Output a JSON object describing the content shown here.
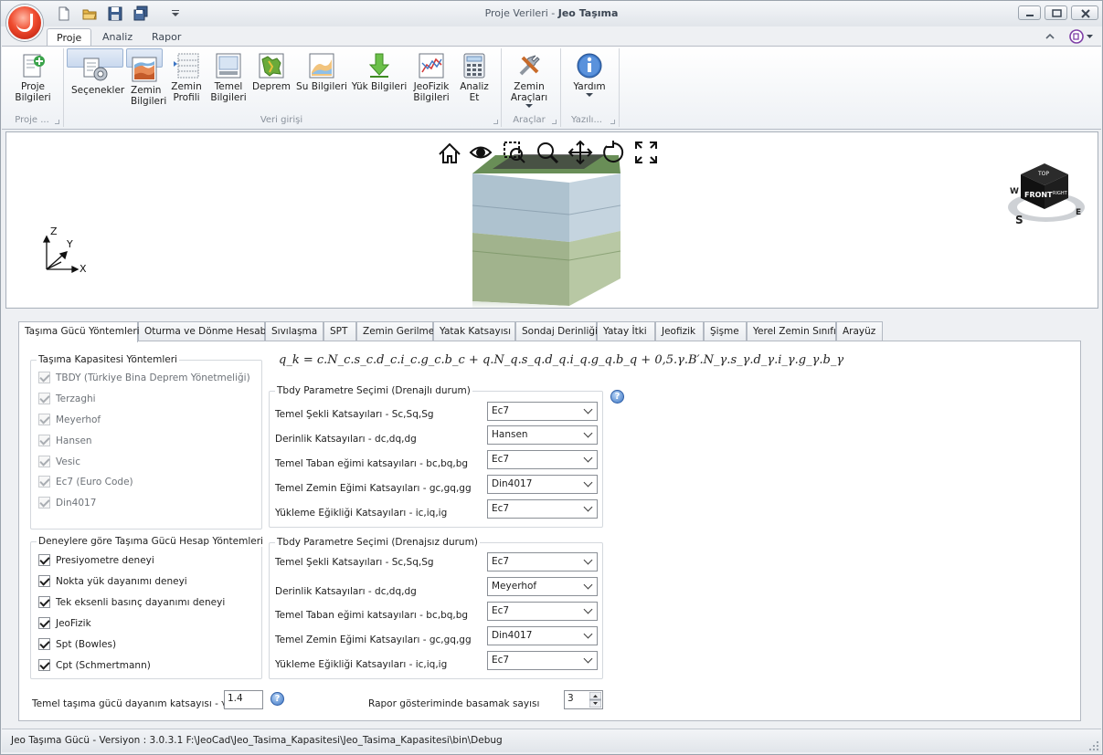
{
  "window": {
    "title_main": "Proje Verileri",
    "title_sep": " - ",
    "title_app": "Jeo Taşıma"
  },
  "ribbon_tabs": [
    "Proje",
    "Analiz",
    "Rapor"
  ],
  "ribbon": {
    "buttons": [
      {
        "line1": "Proje",
        "line2": "Bilgileri",
        "icon": "project-info-icon"
      },
      {
        "line1": "Seçenekler",
        "line2": "",
        "icon": "options-gear-icon"
      },
      {
        "line1": "Zemin",
        "line2": "Bilgileri",
        "icon": "soil-layers-icon"
      },
      {
        "line1": "Zemin",
        "line2": "Profili",
        "icon": "soil-profile-icon"
      },
      {
        "line1": "Temel",
        "line2": "Bilgileri",
        "icon": "foundation-icon"
      },
      {
        "line1": "Deprem",
        "line2": "",
        "icon": "earthquake-map-icon"
      },
      {
        "line1": "Su Bilgileri",
        "line2": "",
        "icon": "water-icon"
      },
      {
        "line1": "Yük Bilgileri",
        "line2": "",
        "icon": "load-arrow-icon"
      },
      {
        "line1": "JeoFizik",
        "line2": "Bilgileri",
        "icon": "geophysics-chart-icon"
      },
      {
        "line1": "Analiz",
        "line2": "Et",
        "icon": "calculator-icon"
      },
      {
        "line1": "Zemin",
        "line2": "Araçları",
        "icon": "tools-icon"
      },
      {
        "line1": "Yardım",
        "line2": "",
        "icon": "info-icon"
      }
    ],
    "groups": [
      "Proje ...",
      "Veri girişi",
      "Araçlar",
      "Yazılı..."
    ]
  },
  "viewer": {
    "axis_labels": [
      "Z",
      "Y",
      "X"
    ],
    "cube_labels": {
      "front": "FRONT",
      "top": "TOP",
      "right": "RIGHT"
    },
    "compass": [
      "W",
      "S",
      "E"
    ]
  },
  "tabs": [
    "Taşıma Gücü Yöntemleri",
    "Oturma ve Dönme Hesabı",
    "Sıvılaşma",
    "SPT",
    "Zemin Gerilme",
    "Yatak Katsayısı",
    "Sondaj Derinliği",
    "Yatay İtki",
    "Jeofizik",
    "Şişme",
    "Yerel Zemin Sınıfı",
    "Arayüz"
  ],
  "methods_group": {
    "title": "Taşıma Kapasitesi Yöntemleri",
    "items": [
      {
        "label": "TBDY (Türkiye Bina Deprem Yönetmeliği)",
        "checked": true
      },
      {
        "label": "Terzaghi",
        "checked": true
      },
      {
        "label": "Meyerhof",
        "checked": true
      },
      {
        "label": "Hansen",
        "checked": true
      },
      {
        "label": "Vesic",
        "checked": true
      },
      {
        "label": "Ec7 (Euro Code)",
        "checked": true
      },
      {
        "label": "Din4017",
        "checked": true
      }
    ]
  },
  "tests_group": {
    "title": "Deneylere göre Taşıma Gücü Hesap Yöntemleri",
    "items": [
      {
        "label": "Presiyometre deneyi",
        "checked": true
      },
      {
        "label": "Nokta yük dayanımı deneyi",
        "checked": true
      },
      {
        "label": "Tek eksenli basınç dayanımı deneyi",
        "checked": true
      },
      {
        "label": "JeoFizik",
        "checked": true
      },
      {
        "label": "Spt (Bowles)",
        "checked": true
      },
      {
        "label": "Cpt (Schmertmann)",
        "checked": true
      }
    ]
  },
  "formula": "q_k = c.N_c.s_c.d_c.i_c.g_c.b_c + q.N_q.s_q.d_q.i_q.g_q.b_q + 0,5.γ.B′.N_γ.s_γ.d_γ.i_γ.g_γ.b_γ",
  "drained": {
    "title": "Tbdy Parametre Seçimi (Drenajlı durum)",
    "rows": [
      {
        "label": "Temel Şekli Katsayıları - Sc,Sq,Sg",
        "value": "Ec7"
      },
      {
        "label": "Derinlik Katsayıları - dc,dq,dg",
        "value": "Hansen"
      },
      {
        "label": "Temel Taban eğimi katsayıları - bc,bq,bg",
        "value": "Ec7"
      },
      {
        "label": "Temel Zemin Eğimi Katsayıları - gc,gq,gg",
        "value": "Din4017"
      },
      {
        "label": "Yükleme Eğikliği Katsayıları - ic,iq,ig",
        "value": "Ec7"
      }
    ]
  },
  "undrained": {
    "title": "Tbdy Parametre Seçimi  (Drenajsız durum)",
    "rows": [
      {
        "label": "Temel Şekli Katsayıları - Sc,Sq,Sg",
        "value": "Ec7"
      },
      {
        "label": "Derinlik Katsayıları - dc,dq,dg",
        "value": "Meyerhof"
      },
      {
        "label": "Temel Taban eğimi katsayıları - bc,bq,bg",
        "value": "Ec7"
      },
      {
        "label": "Temel Zemin Eğimi Katsayıları - gc,gq,gg",
        "value": "Din4017"
      },
      {
        "label": "Yükleme Eğikliği Katsayıları - ic,iq,ig",
        "value": "Ec7"
      }
    ]
  },
  "bottom": {
    "coef_label": "Temel taşıma gücü dayanım katsayısı - γRv",
    "coef_value": "1.4",
    "digits_label": "Rapor gösteriminde basamak sayısı",
    "digits_value": "3",
    "help_glyph": "?"
  },
  "status": {
    "text": "Jeo Taşıma Gücü - Versiyon : 3.0.3.1     F:\\JeoCad\\Jeo_Tasima_Kapasitesi\\Jeo_Tasima_Kapasitesi\\bin\\Debug"
  }
}
